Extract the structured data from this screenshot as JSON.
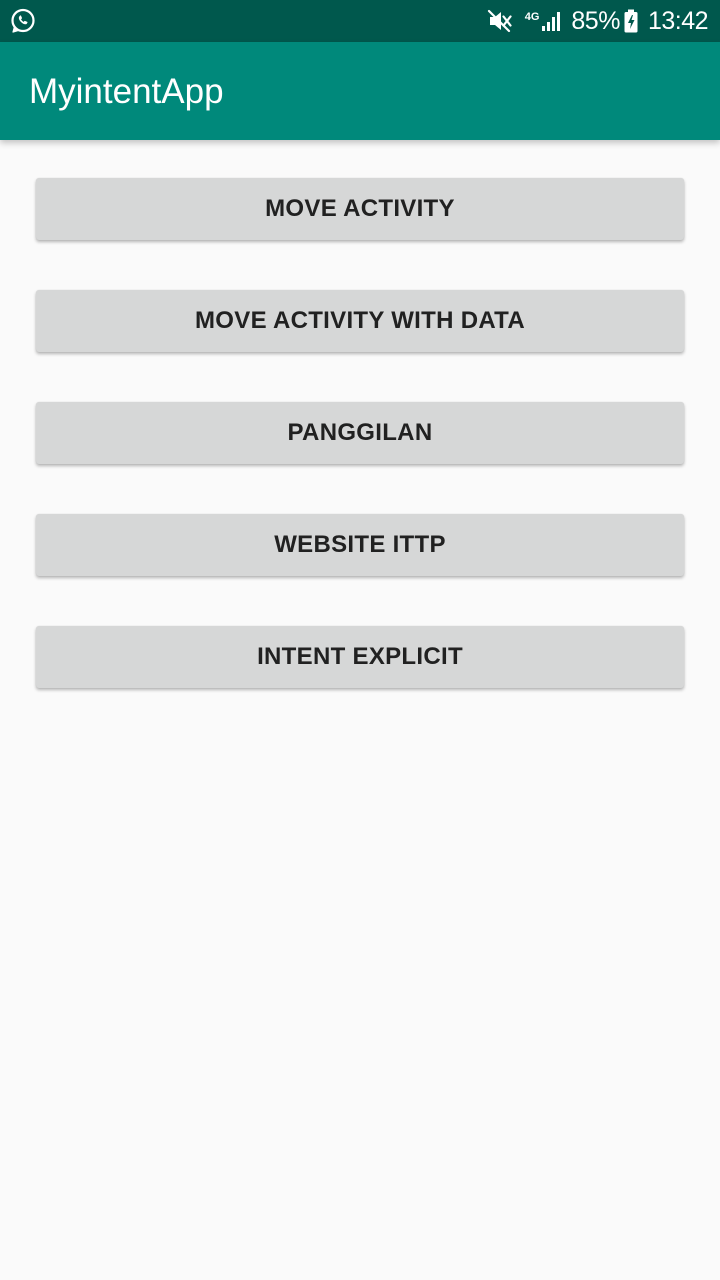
{
  "status_bar": {
    "left_icon": "whatsapp-icon",
    "mute_icon": "mute-icon",
    "network_type": "4G",
    "signal_icon": "signal-icon",
    "battery_percent": "85%",
    "battery_icon": "battery-charging-icon",
    "time": "13:42",
    "background_color": "#00584d"
  },
  "app_bar": {
    "title": "MyintentApp",
    "background_color": "#00897b"
  },
  "buttons": [
    {
      "label": "MOVE ACTIVITY"
    },
    {
      "label": "MOVE ACTIVITY WITH DATA"
    },
    {
      "label": "PANGGILAN"
    },
    {
      "label": "WEBSITE ITTP"
    },
    {
      "label": "INTENT EXPLICIT"
    }
  ],
  "colors": {
    "button_background": "#d6d7d7",
    "page_background": "#fafafa"
  }
}
